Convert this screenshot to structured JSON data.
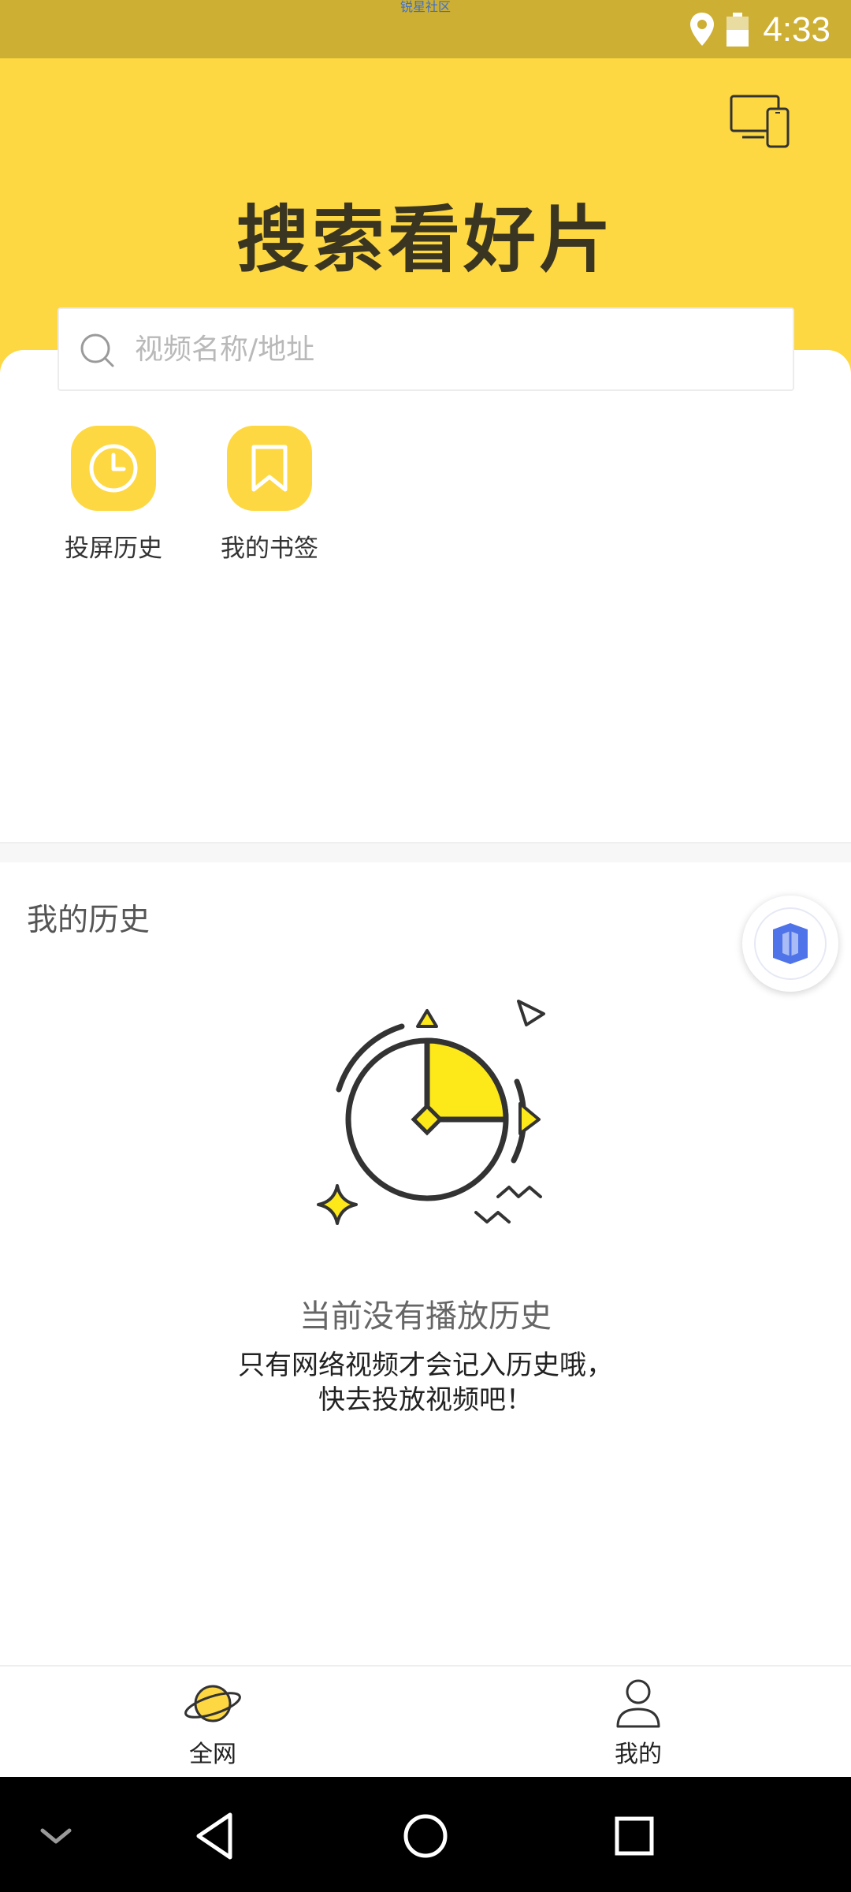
{
  "status_bar": {
    "watermark": "锐星社区",
    "time": "4:33",
    "icons": [
      "location-icon",
      "battery-icon"
    ]
  },
  "header": {
    "headline": "搜索看好片",
    "cast_icon": "cast-device-icon",
    "background_color": "#fdd842"
  },
  "search": {
    "placeholder": "视频名称/地址"
  },
  "quick_actions": [
    {
      "label": "投屏历史",
      "icon": "clock-icon"
    },
    {
      "label": "我的书签",
      "icon": "bookmark-icon"
    }
  ],
  "history": {
    "title": "我的历史",
    "empty_title": "当前没有播放历史",
    "empty_line1": "只有网络视频才会记入历史哦，",
    "empty_line2": "快去投放视频吧！",
    "float_icon": "cube-icon"
  },
  "tabs": [
    {
      "label": "全网",
      "icon": "planet-icon"
    },
    {
      "label": "我的",
      "icon": "person-icon"
    }
  ],
  "nav": [
    "collapse-icon",
    "back-icon",
    "home-icon",
    "recents-icon"
  ]
}
